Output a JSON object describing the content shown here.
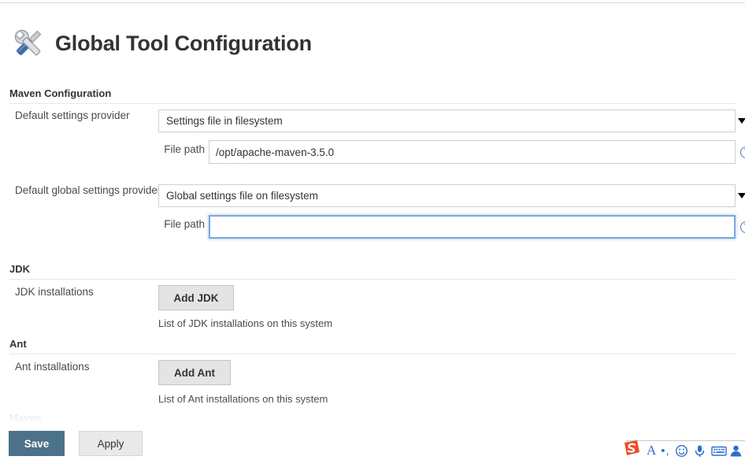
{
  "header": {
    "title": "Global Tool Configuration",
    "icon": "tools-wrench-screwdriver-icon"
  },
  "sections": [
    {
      "id": "maven-configuration",
      "heading": "Maven Configuration",
      "rows": [
        {
          "label": "Default settings provider",
          "control": "select",
          "value": "Settings file in filesystem"
        },
        {
          "label": "File path",
          "control": "text",
          "value": "/opt/apache-maven-3.5.0",
          "focused": false
        },
        {
          "label": "Default global settings provider",
          "control": "select",
          "value": "Global settings file on filesystem"
        },
        {
          "label": "File path",
          "control": "text",
          "value": "",
          "focused": true
        }
      ]
    },
    {
      "id": "jdk",
      "heading": "JDK",
      "rows": [
        {
          "label": "JDK installations",
          "control": "button",
          "value": "Add JDK",
          "hint": "List of JDK installations on this system"
        }
      ]
    },
    {
      "id": "ant",
      "heading": "Ant",
      "rows": [
        {
          "label": "Ant installations",
          "control": "button",
          "value": "Add Ant",
          "hint": "List of Ant installations on this system"
        }
      ]
    },
    {
      "id": "maven",
      "heading": "Maven",
      "rows": []
    }
  ],
  "help_icon_label": "?",
  "footer": {
    "save_label": "Save",
    "apply_label": "Apply",
    "save_color": "#4b7289",
    "apply_color": "#e9e9e9"
  },
  "ime_toolbar": {
    "logo": "sogou-s-logo-icon",
    "logo_color": "#f04b23",
    "accent_color": "#2c6fd1",
    "items": [
      "letter-a-icon",
      "punctuation-icon",
      "emoji-smiley-icon",
      "microphone-icon",
      "keyboard-icon",
      "user-profile-icon"
    ]
  }
}
